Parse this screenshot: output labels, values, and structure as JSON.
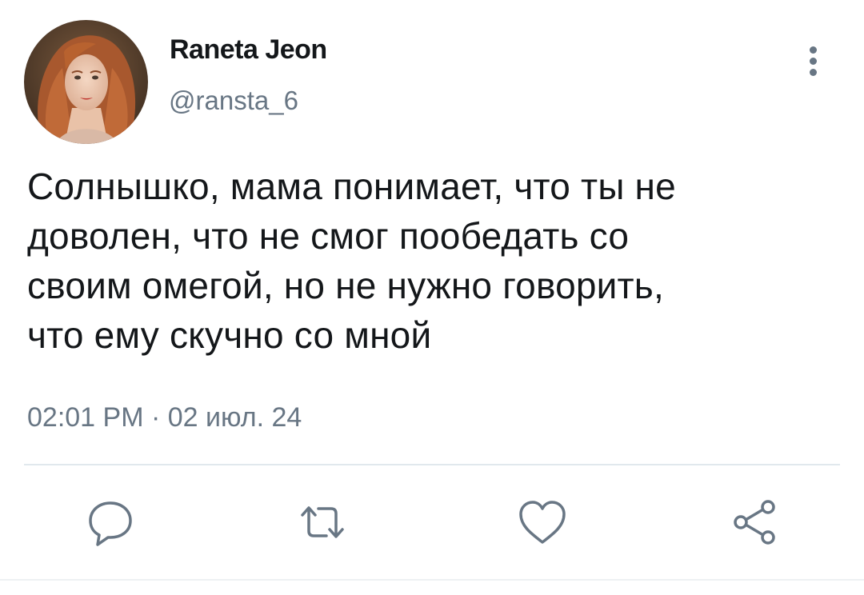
{
  "tweet": {
    "author": {
      "display_name": "Raneta Jeon",
      "handle": "@ransta_6",
      "avatar_icon": "profile-photo"
    },
    "text_lines": [
      "Солнышко, мама понимает, что ты не",
      "доволен, что не смог пообедать со",
      "своим омегой, но не нужно говорить,",
      "что ему скучно со мной"
    ],
    "timestamp": "02:01 PM · 02 июл. 24",
    "menu_icon": "more-vertical-icon"
  },
  "actions": [
    {
      "name": "reply",
      "icon": "reply-icon"
    },
    {
      "name": "retweet",
      "icon": "retweet-icon"
    },
    {
      "name": "like",
      "icon": "heart-icon"
    },
    {
      "name": "share",
      "icon": "share-icon"
    }
  ],
  "colors": {
    "text_primary": "#14171a",
    "text_secondary": "#687684",
    "divider": "#e1e8ed"
  }
}
